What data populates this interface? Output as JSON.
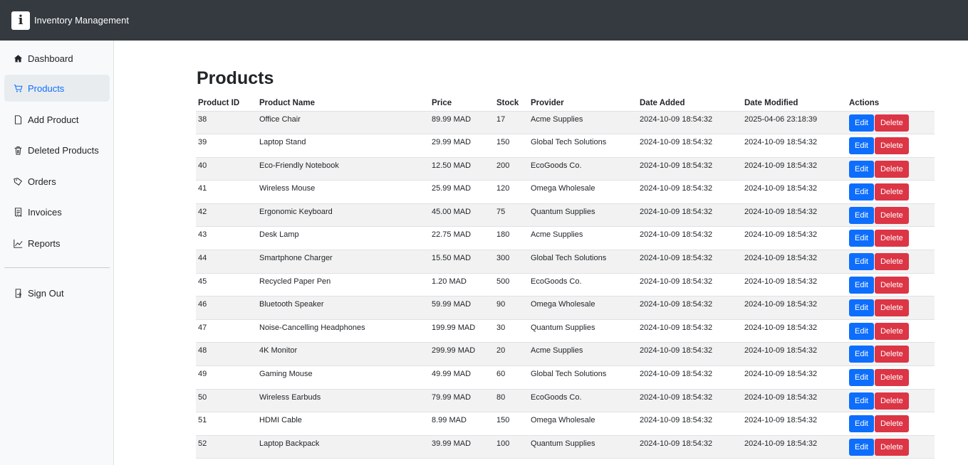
{
  "header": {
    "logo_letter": "i",
    "title": "Inventory Management"
  },
  "sidebar": {
    "items": [
      {
        "label": "Dashboard",
        "icon": "home-icon",
        "active": false
      },
      {
        "label": "Products",
        "icon": "cart-icon",
        "active": true
      },
      {
        "label": "Add Product",
        "icon": "file-icon",
        "active": false
      },
      {
        "label": "Deleted Products",
        "icon": "trash-icon",
        "active": false
      },
      {
        "label": "Orders",
        "icon": "tag-icon",
        "active": false
      },
      {
        "label": "Invoices",
        "icon": "receipt-icon",
        "active": false
      },
      {
        "label": "Reports",
        "icon": "chart-icon",
        "active": false
      }
    ],
    "signout": {
      "label": "Sign Out",
      "icon": "signout-icon"
    }
  },
  "main": {
    "title": "Products",
    "columns": [
      "Product ID",
      "Product Name",
      "Price",
      "Stock",
      "Provider",
      "Date Added",
      "Date Modified",
      "Actions"
    ],
    "edit_label": "Edit",
    "delete_label": "Delete",
    "rows": [
      [
        "38",
        "Office Chair",
        "89.99 MAD",
        "17",
        "Acme Supplies",
        "2024-10-09 18:54:32",
        "2025-04-06 23:18:39"
      ],
      [
        "39",
        "Laptop Stand",
        "29.99 MAD",
        "150",
        "Global Tech Solutions",
        "2024-10-09 18:54:32",
        "2024-10-09 18:54:32"
      ],
      [
        "40",
        "Eco-Friendly Notebook",
        "12.50 MAD",
        "200",
        "EcoGoods Co.",
        "2024-10-09 18:54:32",
        "2024-10-09 18:54:32"
      ],
      [
        "41",
        "Wireless Mouse",
        "25.99 MAD",
        "120",
        "Omega Wholesale",
        "2024-10-09 18:54:32",
        "2024-10-09 18:54:32"
      ],
      [
        "42",
        "Ergonomic Keyboard",
        "45.00 MAD",
        "75",
        "Quantum Supplies",
        "2024-10-09 18:54:32",
        "2024-10-09 18:54:32"
      ],
      [
        "43",
        "Desk Lamp",
        "22.75 MAD",
        "180",
        "Acme Supplies",
        "2024-10-09 18:54:32",
        "2024-10-09 18:54:32"
      ],
      [
        "44",
        "Smartphone Charger",
        "15.50 MAD",
        "300",
        "Global Tech Solutions",
        "2024-10-09 18:54:32",
        "2024-10-09 18:54:32"
      ],
      [
        "45",
        "Recycled Paper Pen",
        "1.20 MAD",
        "500",
        "EcoGoods Co.",
        "2024-10-09 18:54:32",
        "2024-10-09 18:54:32"
      ],
      [
        "46",
        "Bluetooth Speaker",
        "59.99 MAD",
        "90",
        "Omega Wholesale",
        "2024-10-09 18:54:32",
        "2024-10-09 18:54:32"
      ],
      [
        "47",
        "Noise-Cancelling Headphones",
        "199.99 MAD",
        "30",
        "Quantum Supplies",
        "2024-10-09 18:54:32",
        "2024-10-09 18:54:32"
      ],
      [
        "48",
        "4K Monitor",
        "299.99 MAD",
        "20",
        "Acme Supplies",
        "2024-10-09 18:54:32",
        "2024-10-09 18:54:32"
      ],
      [
        "49",
        "Gaming Mouse",
        "49.99 MAD",
        "60",
        "Global Tech Solutions",
        "2024-10-09 18:54:32",
        "2024-10-09 18:54:32"
      ],
      [
        "50",
        "Wireless Earbuds",
        "79.99 MAD",
        "80",
        "EcoGoods Co.",
        "2024-10-09 18:54:32",
        "2024-10-09 18:54:32"
      ],
      [
        "51",
        "HDMI Cable",
        "8.99 MAD",
        "150",
        "Omega Wholesale",
        "2024-10-09 18:54:32",
        "2024-10-09 18:54:32"
      ],
      [
        "52",
        "Laptop Backpack",
        "39.99 MAD",
        "100",
        "Quantum Supplies",
        "2024-10-09 18:54:32",
        "2024-10-09 18:54:32"
      ]
    ]
  },
  "colors": {
    "topbar": "#343a40",
    "sidebar": "#f8f9fa",
    "accent": "#0d6efd",
    "danger": "#dc3545",
    "stripe": "#f2f2f2"
  }
}
